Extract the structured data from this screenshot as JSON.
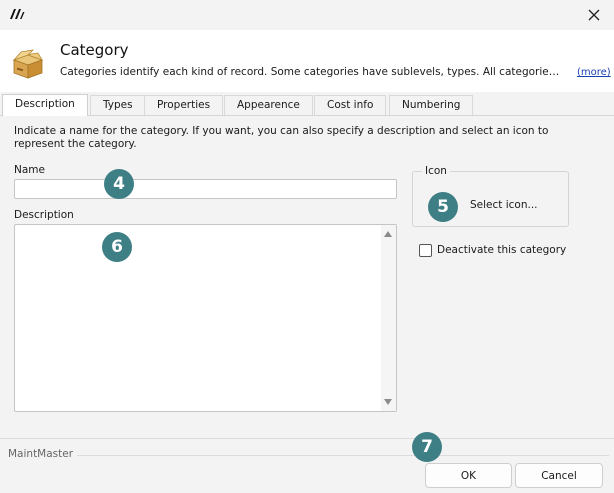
{
  "titlebar": {
    "close_icon": "close-icon",
    "logo_icon": "app-logo-icon"
  },
  "header": {
    "icon": "box-icon",
    "title": "Category",
    "description": "Categories identify each kind of record. Some categories have sublevels, types. All categories ca...",
    "more_link": "(more)"
  },
  "tabs": [
    {
      "label": "Description",
      "active": true
    },
    {
      "label": "Types",
      "active": false
    },
    {
      "label": "Properties",
      "active": false
    },
    {
      "label": "Appearence",
      "active": false
    },
    {
      "label": "Cost info",
      "active": false
    },
    {
      "label": "Numbering",
      "active": false
    }
  ],
  "form": {
    "intro": "Indicate a name for the category. If you want, you can also specify a description and select an icon to represent the category.",
    "name_label": "Name",
    "name_value": "",
    "description_label": "Description",
    "description_value": "",
    "icon_group_label": "Icon",
    "select_icon_label": "Select icon...",
    "deactivate_label": "Deactivate this category",
    "deactivate_checked": false
  },
  "footer": {
    "brand": "MaintMaster",
    "ok_label": "OK",
    "cancel_label": "Cancel"
  },
  "markers": [
    "4",
    "5",
    "6",
    "7"
  ],
  "colors": {
    "marker": "#3e7f86",
    "link": "#1a3fb0",
    "background": "#f3f3f3"
  }
}
